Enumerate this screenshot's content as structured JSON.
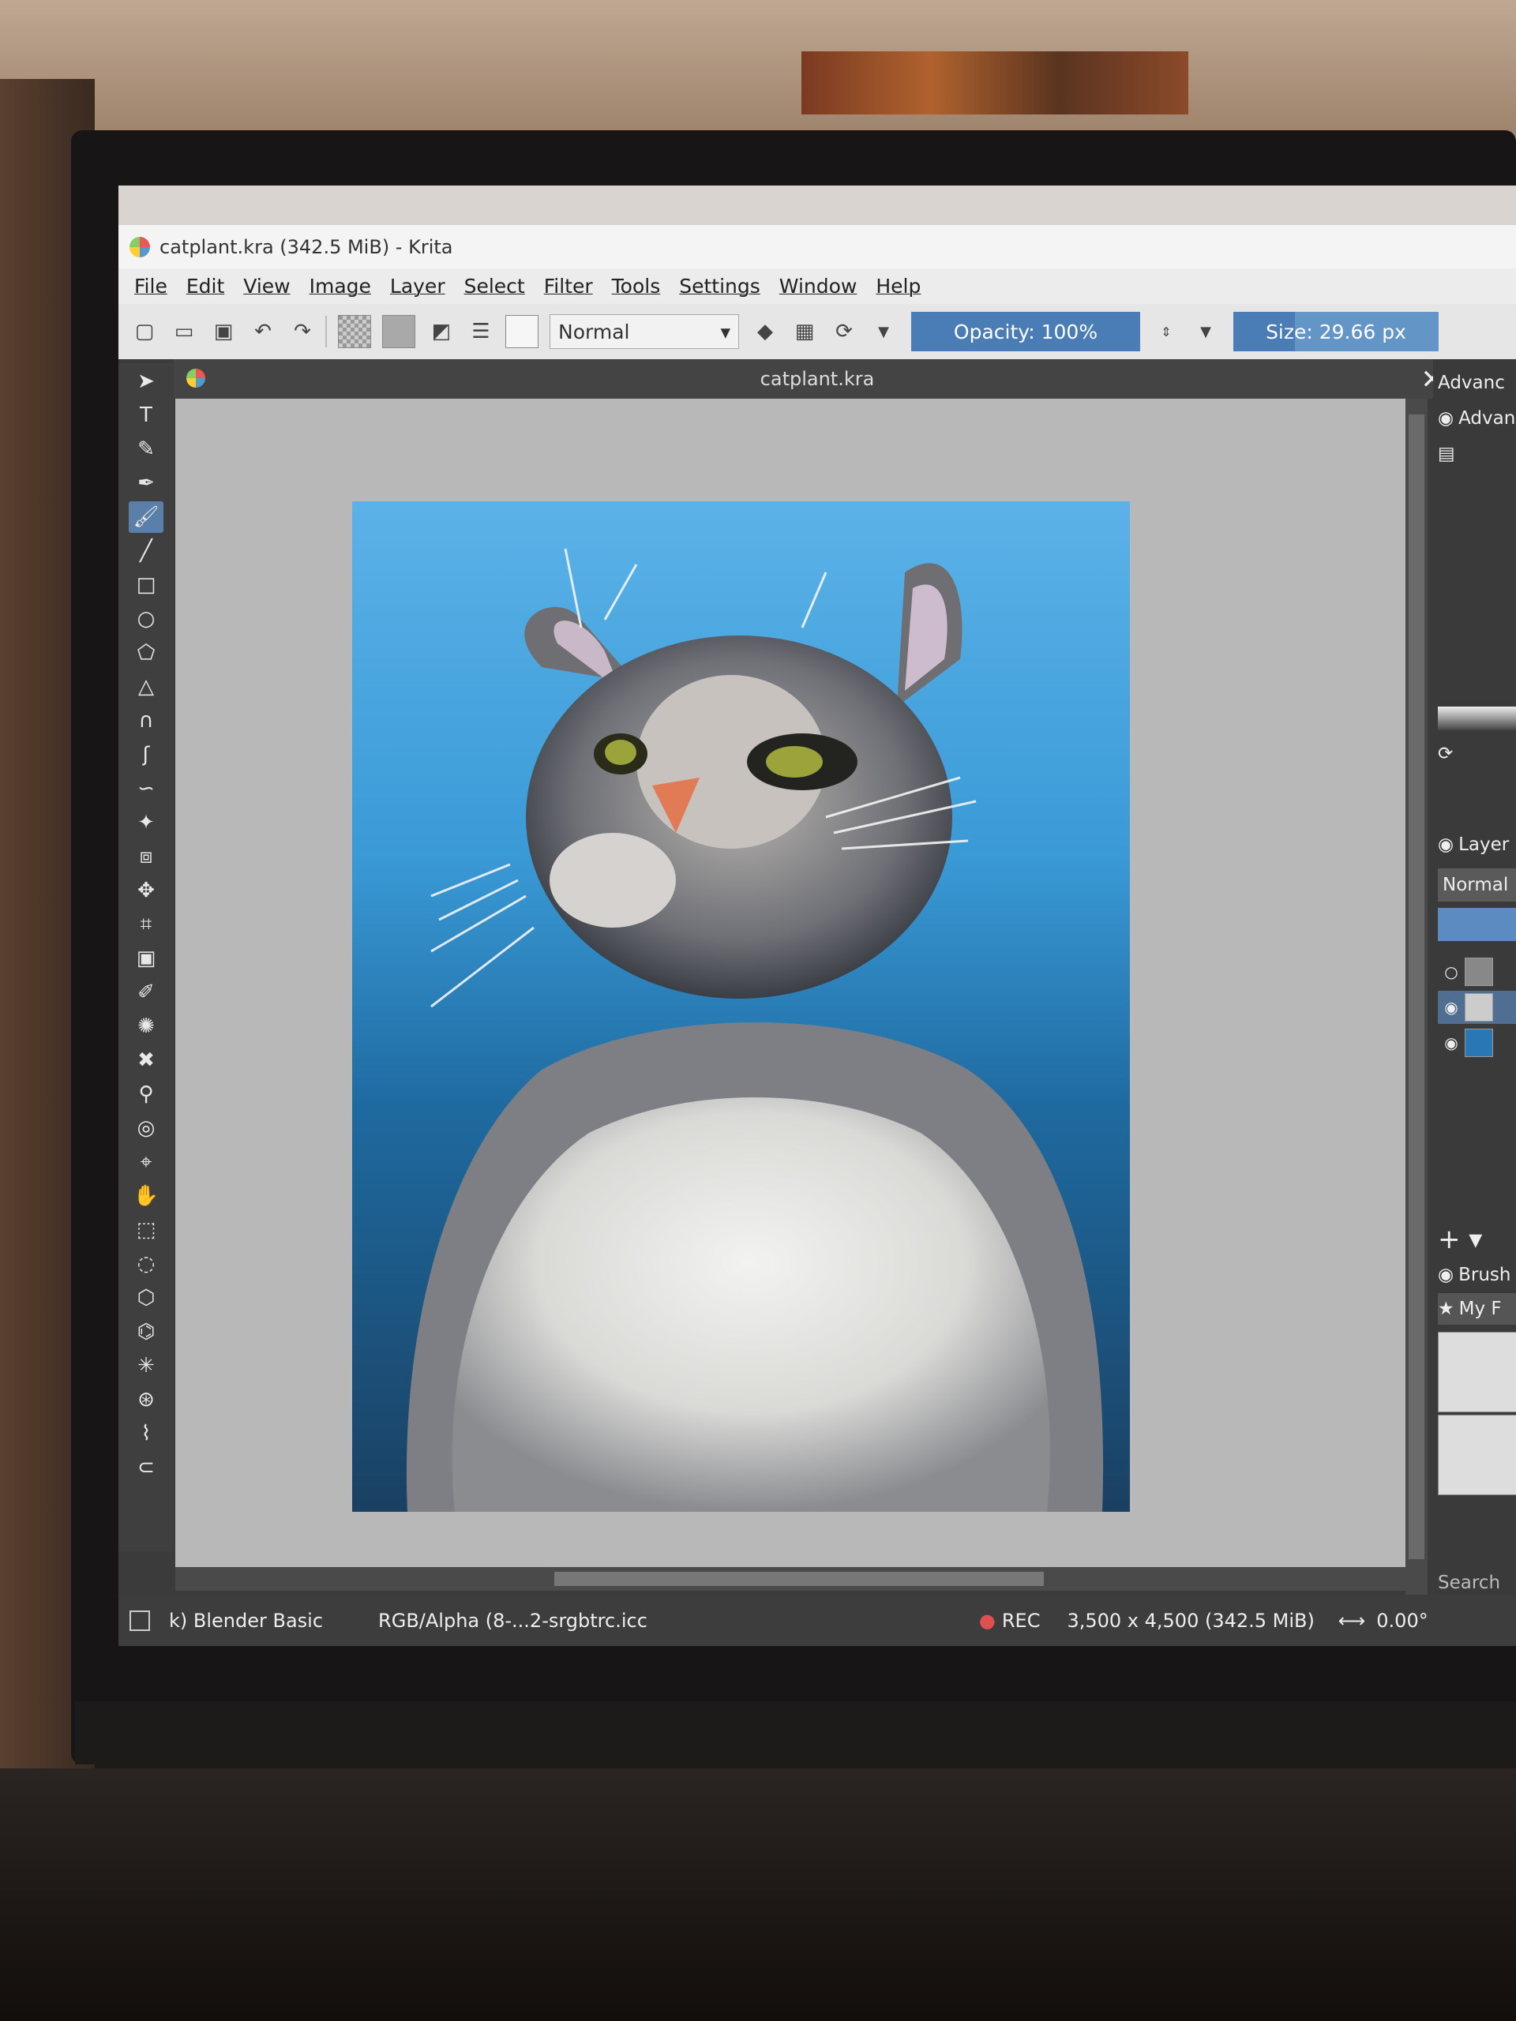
{
  "window": {
    "title": "catplant.kra (342.5 MiB)  - Krita"
  },
  "menu": [
    "File",
    "Edit",
    "View",
    "Image",
    "Layer",
    "Select",
    "Filter",
    "Tools",
    "Settings",
    "Window",
    "Help"
  ],
  "toolbar": {
    "blend_mode": "Normal",
    "opacity_label": "Opacity: 100%",
    "opacity_value": 100,
    "size_label": "Size: 29.66 px",
    "icons": [
      "new-document-icon",
      "open-document-icon",
      "save-icon",
      "undo-icon",
      "redo-icon",
      "pattern-swatch-icon",
      "gradient-swatch-icon",
      "swap-colors-icon",
      "brush-presets-icon",
      "brush-tip-icon",
      "eraser-icon",
      "alpha-lock-icon",
      "reload-icon"
    ]
  },
  "document": {
    "tab_title": "catplant.kra"
  },
  "tools": [
    "select-shapes-icon",
    "text-tool-icon",
    "edit-shapes-icon",
    "calligraphy-icon",
    "freehand-brush-icon",
    "line-tool-icon",
    "rectangle-tool-icon",
    "ellipse-tool-icon",
    "polygon-tool-icon",
    "polyline-tool-icon",
    "bezier-tool-icon",
    "freehand-path-icon",
    "dynamic-brush-icon",
    "multibrush-icon",
    "transform-tool-icon",
    "move-tool-icon",
    "crop-tool-icon",
    "gradient-tool-icon",
    "color-picker-icon",
    "smart-patch-icon",
    "fill-tool-icon",
    "assistant-tool-icon",
    "reference-tool-icon",
    "measure-tool-icon",
    "pan-tool-icon",
    "rect-select-icon",
    "ellipse-select-icon",
    "polygon-select-icon",
    "freehand-select-icon",
    "contiguous-select-icon",
    "similar-select-icon",
    "bezier-select-icon",
    "magnetic-select-icon"
  ],
  "dock": {
    "advanced_tab": "Advanc",
    "advanced_header": "Advan",
    "layers_header": "Layer",
    "layers_blend": "Normal",
    "brushes_header": "Brush",
    "brushes_filter": "My F",
    "search_label": "Search"
  },
  "status": {
    "brush": "k) Blender Basic",
    "color_profile": "RGB/Alpha (8-...2-srgbtrc.icc",
    "rec": "REC",
    "image_size": "3,500 x 4,500 (342.5 MiB)",
    "rotation": "0.00°"
  },
  "colors": {
    "accent": "#5b8bc0",
    "rec_dot": "#e05050",
    "canvas_bg": "#b8b8b8"
  }
}
